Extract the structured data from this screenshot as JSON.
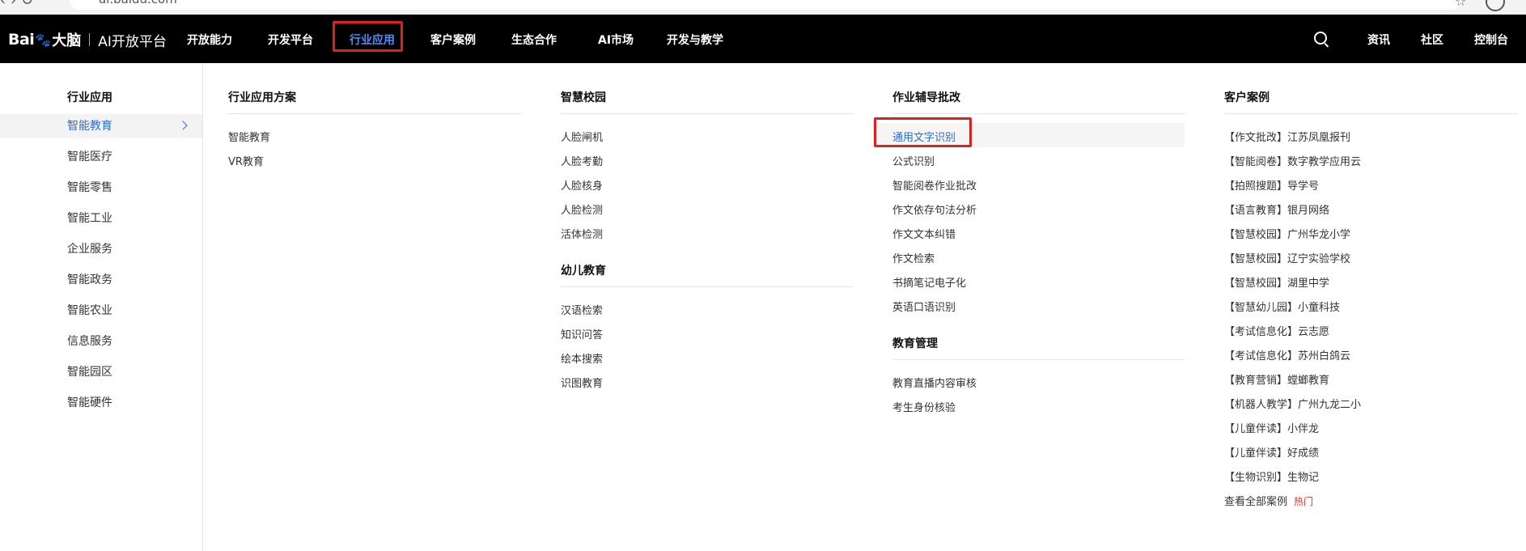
{
  "browser": {
    "url": "ai.baidu.com"
  },
  "header": {
    "logo": {
      "bai": "Bai",
      "paw": "🐾",
      "dn": "大脑",
      "ai": "AI开放平台"
    },
    "nav": [
      "开放能力",
      "开发平台",
      "行业应用",
      "客户案例",
      "生态合作",
      "AI市场",
      "开发与教学"
    ],
    "active_nav": "行业应用",
    "right": [
      "资讯",
      "社区",
      "控制台"
    ],
    "colors": {
      "bg": "#000000",
      "active": "#4e8df5",
      "highlight": "#e02020"
    }
  },
  "sidebar": {
    "title": "行业应用",
    "items": [
      "智能教育",
      "智能医疗",
      "智能零售",
      "智能工业",
      "企业服务",
      "智能政务",
      "智能农业",
      "信息服务",
      "智能园区",
      "智能硬件"
    ],
    "active": "智能教育"
  },
  "columns": {
    "solutions": {
      "title": "行业应用方案",
      "links": [
        "智能教育",
        "VR教育"
      ]
    },
    "campus": {
      "title": "智慧校园",
      "links": [
        "人脸闸机",
        "人脸考勤",
        "人脸核身",
        "人脸检测",
        "活体检测"
      ]
    },
    "preschool": {
      "title": "幼儿教育",
      "links": [
        "汉语检索",
        "知识问答",
        "绘本搜索",
        "识图教育"
      ]
    },
    "homework": {
      "title": "作业辅导批改",
      "links": [
        "通用文字识别",
        "公式识别",
        "智能阅卷作业批改",
        "作文依存句法分析",
        "作文文本纠错",
        "作文检索",
        "书摘笔记电子化",
        "英语口语识别"
      ]
    },
    "edu_mgmt": {
      "title": "教育管理",
      "links": [
        "教育直播内容审核",
        "考生身份核验"
      ]
    },
    "cases": {
      "title": "客户案例",
      "links": [
        "【作文批改】江苏凤凰报刊",
        "【智能阅卷】数字教学应用云",
        "【拍照搜题】导学号",
        "【语言教育】银月网络",
        "【智慧校园】广州华龙小学",
        "【智慧校园】辽宁实验学校",
        "【智慧校园】湖里中学",
        "【智慧幼儿园】小童科技",
        "【考试信息化】云志愿",
        "【考试信息化】苏州白鸽云",
        "【教育营销】螳螂教育",
        "【机器人教学】广州九龙二小",
        "【儿童伴读】小伴龙",
        "【儿童伴读】好成绩",
        "【生物识别】生物记"
      ],
      "all": "查看全部案例",
      "hot": "热门"
    }
  }
}
